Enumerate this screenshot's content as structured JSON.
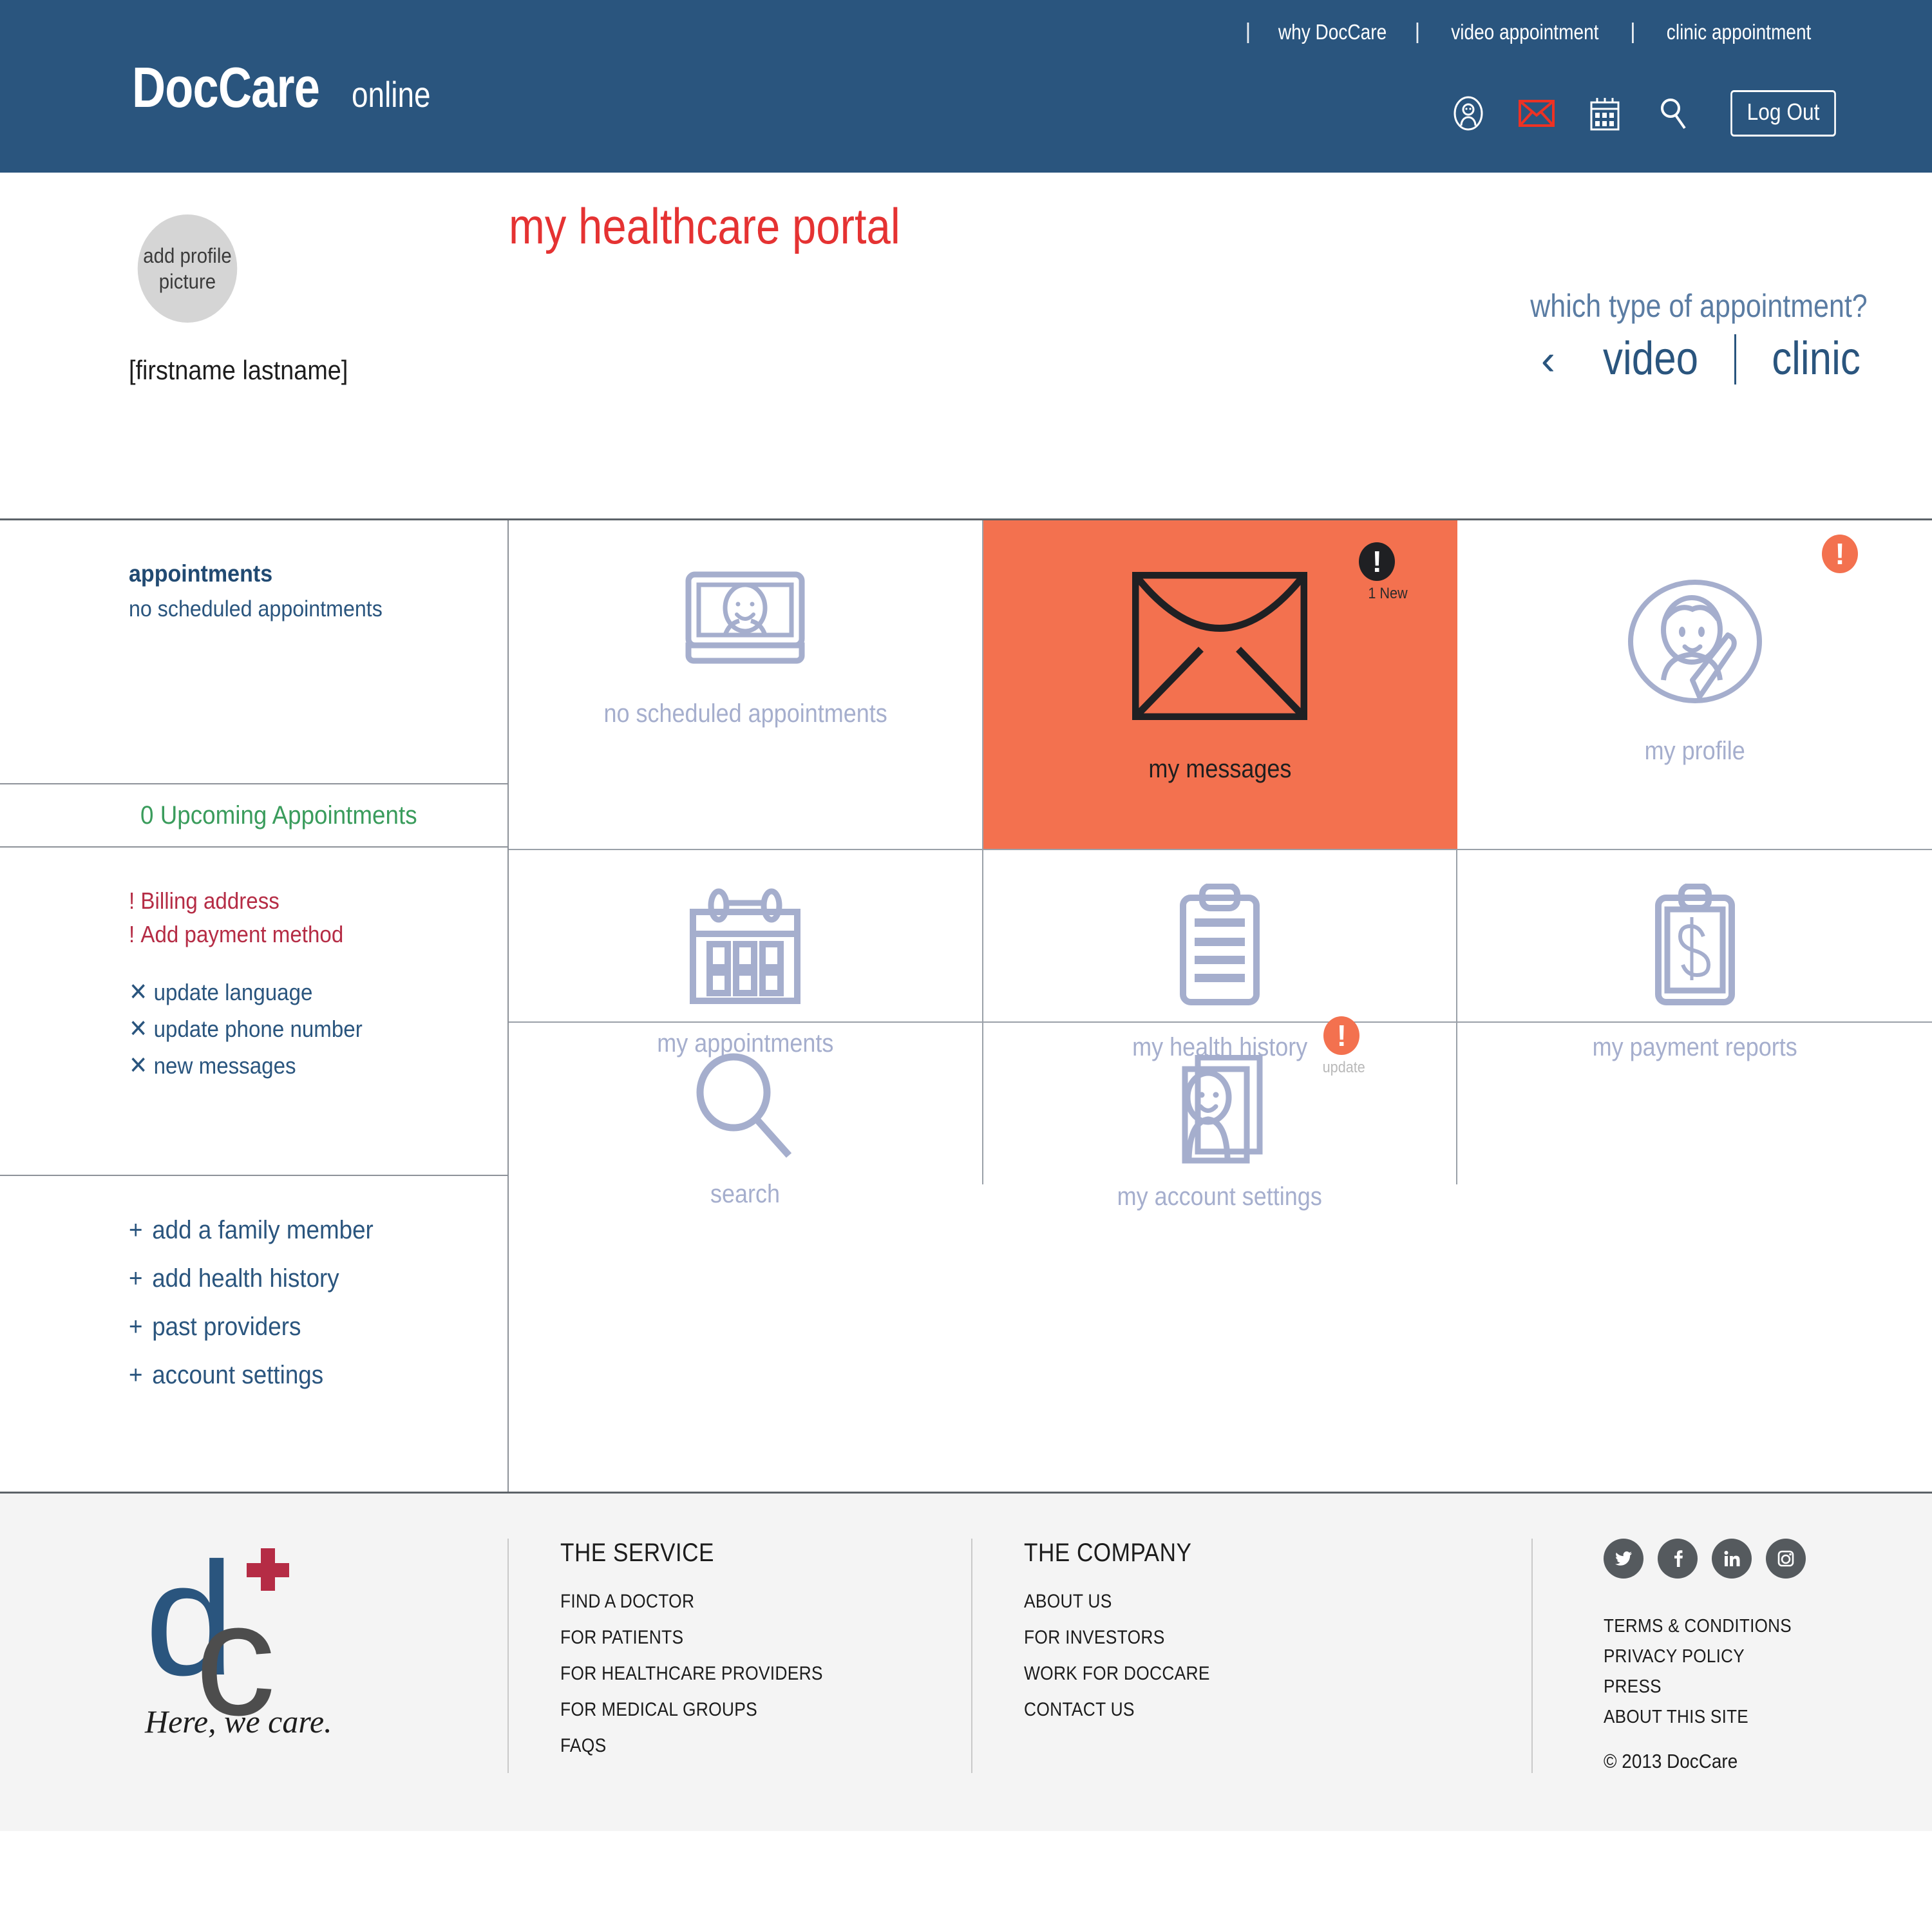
{
  "header": {
    "logo_main": "DocCare",
    "logo_sub": "online",
    "nav": [
      {
        "label": "why DocCare"
      },
      {
        "label": "video appointment"
      },
      {
        "label": "clinic appointment"
      }
    ],
    "icons": [
      {
        "name": "account-icon"
      },
      {
        "name": "envelope-icon"
      },
      {
        "name": "calendar-icon"
      },
      {
        "name": "search-icon"
      }
    ],
    "logout_label": "Log Out",
    "bg_color": "#2a557e"
  },
  "profile": {
    "avatar_line1": "add profile",
    "avatar_line2": "picture",
    "username": "[firstname lastname]",
    "page_title": "my healthcare portal",
    "title_color": "#e53232",
    "appointment_question": "which type of appointment?",
    "prev_arrow": "‹",
    "option_video": "video",
    "option_clinic": "clinic"
  },
  "sidebar": {
    "appointments_title": "appointments",
    "appointments_sub": "no scheduled appointments",
    "upcoming_count": "0",
    "upcoming_label": "Upcoming Appointments",
    "upcoming_color": "#3a9c5c",
    "alerts": [
      {
        "bang": "!",
        "label": "Billing address"
      },
      {
        "bang": "!",
        "label": "Add payment method"
      }
    ],
    "alert_color": "#b52c45",
    "tasks": [
      {
        "mark": "✕",
        "label": "update language"
      },
      {
        "mark": "✕",
        "label": "update phone number"
      },
      {
        "mark": "✕",
        "label": "new messages"
      }
    ],
    "add_links": [
      {
        "sym": "+",
        "label": "add a family member"
      },
      {
        "sym": "+",
        "label": "add health history"
      },
      {
        "sym": "+",
        "label": "past providers"
      },
      {
        "sym": "+",
        "label": "account settings"
      }
    ]
  },
  "tiles": {
    "accent_color": "#f3714f",
    "icon_color": "#a5aecd",
    "items": [
      {
        "icon": "video-call-icon",
        "label": "no scheduled appointments",
        "active": false,
        "badge": null,
        "badge_caption": null
      },
      {
        "icon": "envelope-icon",
        "label": "my messages",
        "active": true,
        "badge": "!",
        "badge_caption": "1 New"
      },
      {
        "icon": "profile-edit-icon",
        "label": "my profile",
        "active": false,
        "badge": "!",
        "badge_caption": null
      },
      {
        "icon": "calendar-icon",
        "label": "my appointments",
        "active": false,
        "badge": null,
        "badge_caption": null
      },
      {
        "icon": "clipboard-lines-icon",
        "label": "my health history",
        "active": false,
        "badge": null,
        "badge_caption": null
      },
      {
        "icon": "clipboard-dollar-icon",
        "label": "my payment reports",
        "active": false,
        "badge": null,
        "badge_caption": null
      },
      {
        "icon": "magnifier-icon",
        "label": "search",
        "active": false,
        "badge": null,
        "badge_caption": null
      },
      {
        "icon": "account-cards-icon",
        "label": "my account settings",
        "active": false,
        "badge": "!",
        "badge_caption": "update"
      },
      {
        "icon": null,
        "label": "",
        "active": false,
        "badge": null,
        "badge_caption": null
      }
    ]
  },
  "footer": {
    "logo_d": "d",
    "logo_c": "c",
    "tagline": "Here, we care.",
    "service": {
      "heading": "THE SERVICE",
      "links": [
        "FIND A DOCTOR",
        "FOR PATIENTS",
        "FOR HEALTHCARE PROVIDERS",
        "FOR MEDICAL GROUPS",
        "FAQS"
      ]
    },
    "company": {
      "heading": "THE COMPANY",
      "links": [
        "ABOUT US",
        "FOR INVESTORS",
        "WORK FOR DOCCARE",
        "CONTACT US"
      ]
    },
    "socials": [
      {
        "name": "twitter-icon"
      },
      {
        "name": "facebook-icon"
      },
      {
        "name": "linkedin-icon"
      },
      {
        "name": "instagram-icon"
      }
    ],
    "legal": [
      "TERMS & CONDITIONS",
      "PRIVACY POLICY",
      "PRESS",
      "ABOUT THIS SITE"
    ],
    "copyright": "© 2013 DocCare"
  }
}
